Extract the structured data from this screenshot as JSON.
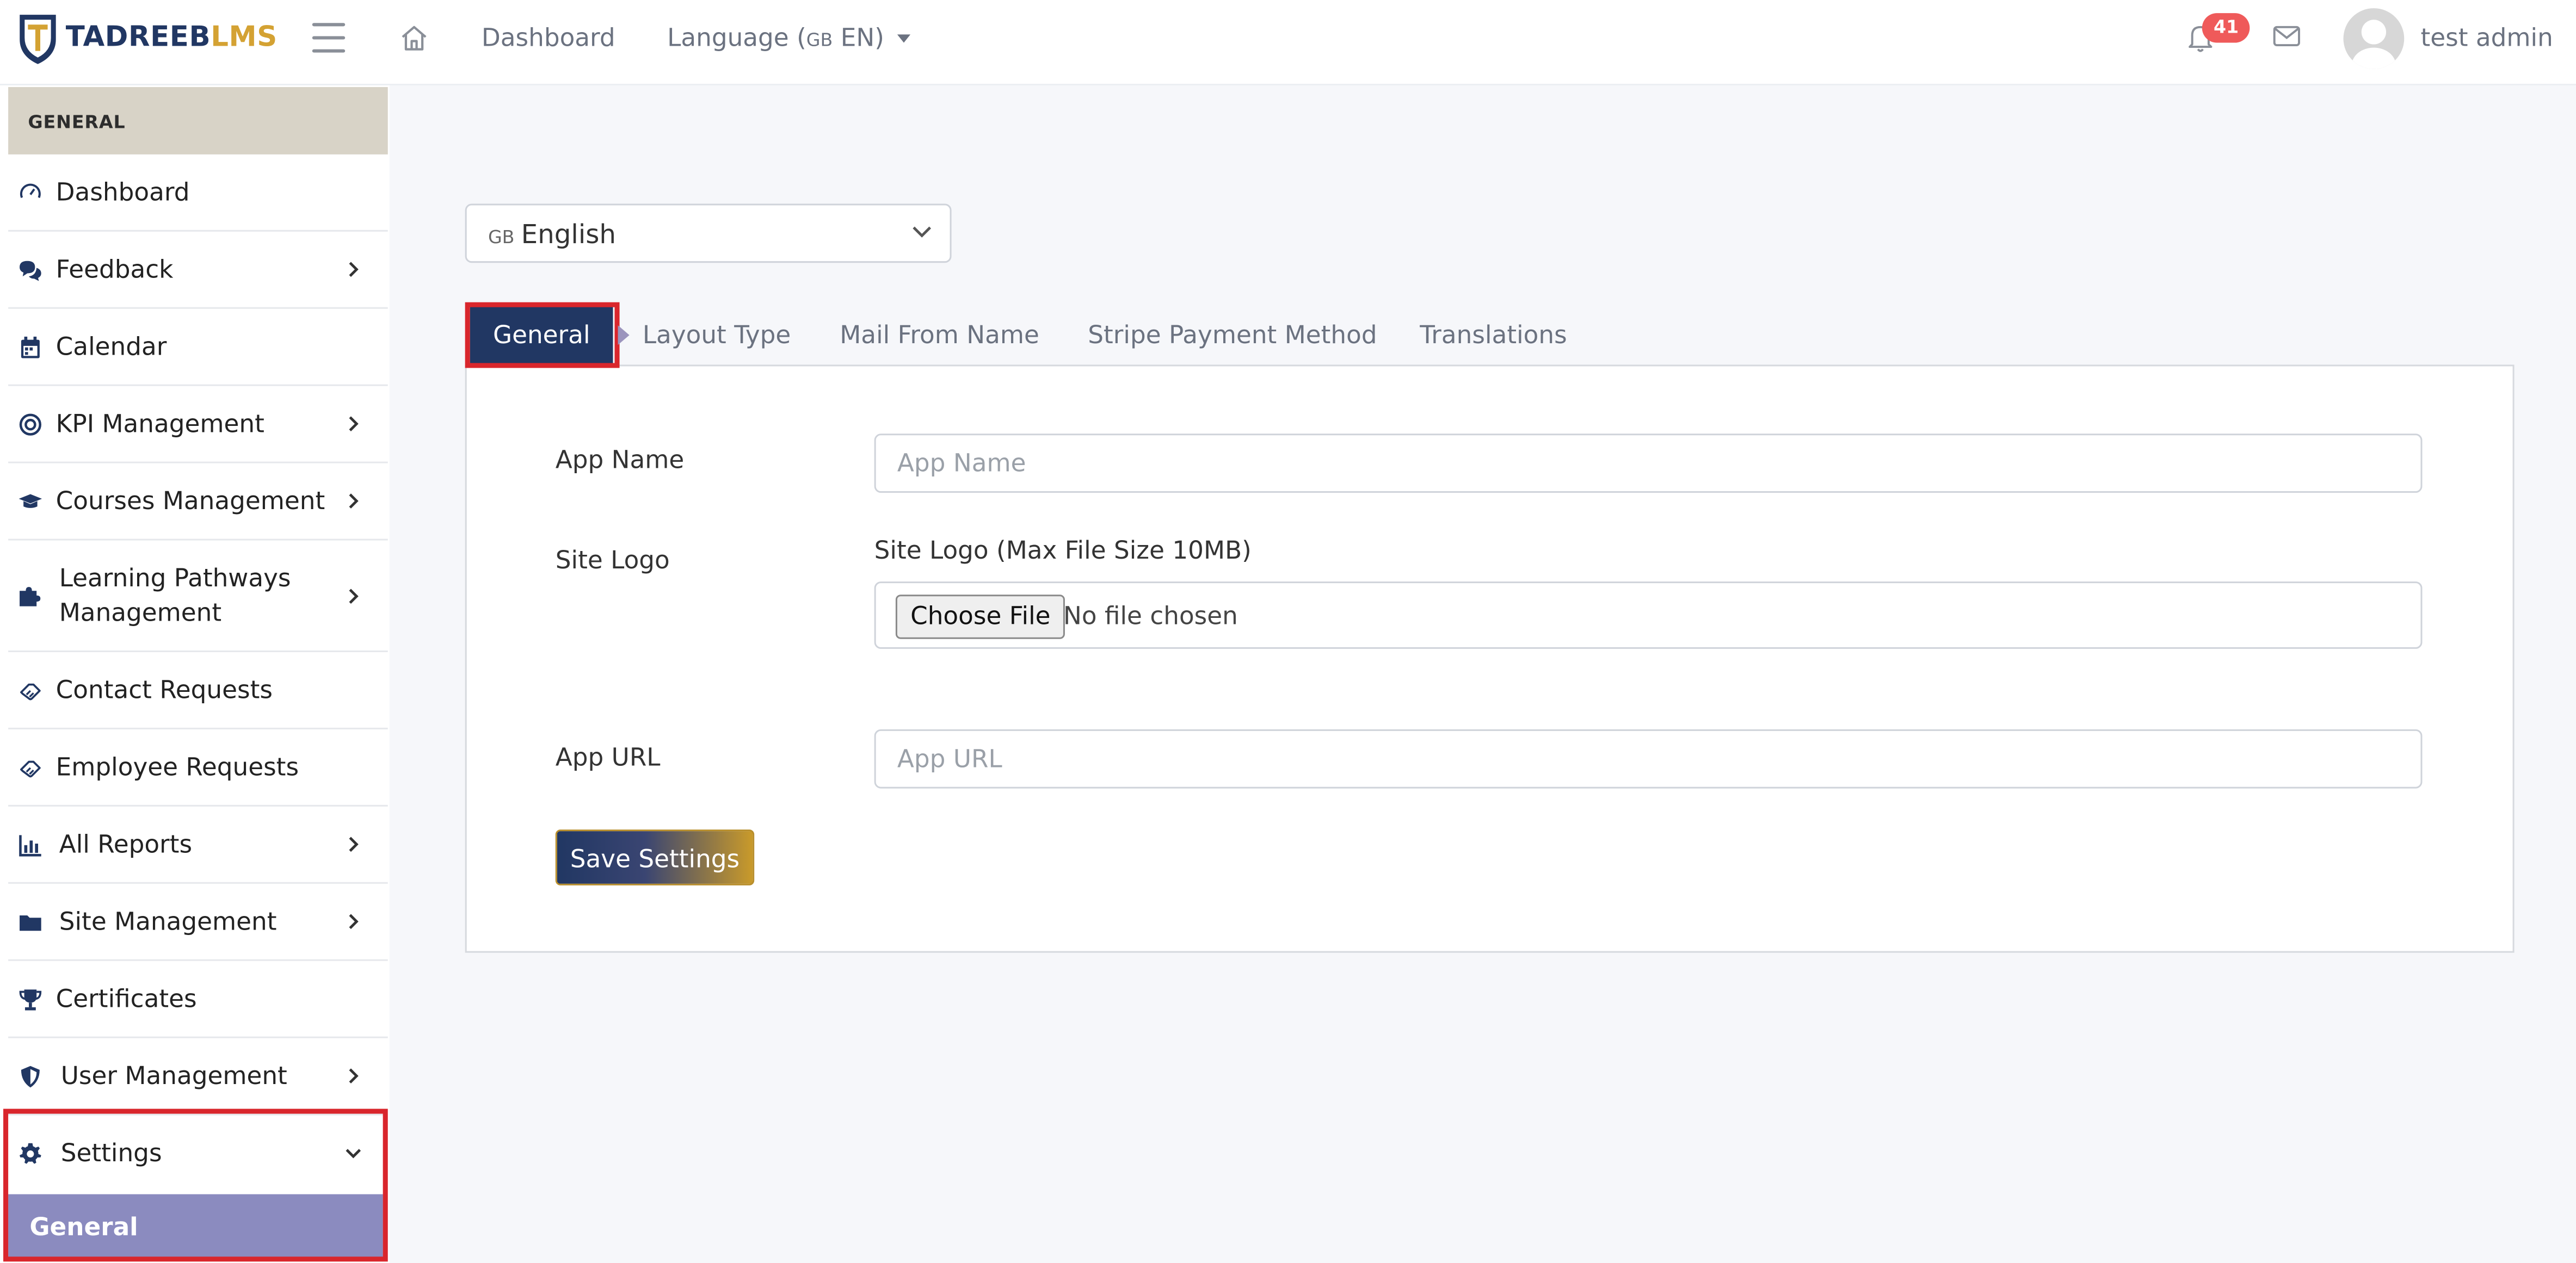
{
  "header": {
    "logo_primary": "TADREEB",
    "logo_secondary": "LMS",
    "dashboard_link": "Dashboard",
    "language_label": "Language (",
    "language_flag": "GB",
    "language_code": " EN)",
    "notification_count": "41",
    "username": "test admin"
  },
  "sidebar": {
    "section_title": "GENERAL",
    "items": [
      {
        "label": "Dashboard",
        "icon": "gauge-icon"
      },
      {
        "label": "Feedback",
        "icon": "comments-icon"
      },
      {
        "label": "Calendar",
        "icon": "calendar-icon"
      },
      {
        "label": "KPI Management",
        "icon": "target-icon"
      },
      {
        "label": "Courses Management",
        "icon": "graduation-cap-icon"
      },
      {
        "label": "Learning Pathways Management",
        "icon": "puzzle-icon"
      },
      {
        "label": "Contact Requests",
        "icon": "handshake-icon"
      },
      {
        "label": "Employee Requests",
        "icon": "handshake-icon"
      },
      {
        "label": "All Reports",
        "icon": "bar-chart-icon"
      },
      {
        "label": "Site Management",
        "icon": "folder-icon"
      },
      {
        "label": "Certificates",
        "icon": "trophy-icon"
      },
      {
        "label": "User Management",
        "icon": "shield-icon"
      },
      {
        "label": "Settings",
        "icon": "gear-icon"
      }
    ],
    "subitem_active": "General"
  },
  "main": {
    "language_select": {
      "flag": "GB",
      "value": "English"
    },
    "tabs": [
      "General",
      "Layout Type",
      "Mail From Name",
      "Stripe Payment Method",
      "Translations"
    ],
    "form": {
      "app_name_label": "App Name",
      "app_name_placeholder": "App Name",
      "site_logo_label": "Site Logo",
      "site_logo_hint": "Site Logo (Max File Size 10MB)",
      "choose_file": "Choose File",
      "no_file": "No file chosen",
      "app_url_label": "App URL",
      "app_url_placeholder": "App URL",
      "save_button": "Save Settings"
    }
  },
  "colors": {
    "brand_navy": "#213763",
    "brand_gold": "#d4a233",
    "highlight_red": "#d9262c",
    "active_submenu": "#8b8bbf",
    "badge_red": "#ef5a5a"
  }
}
